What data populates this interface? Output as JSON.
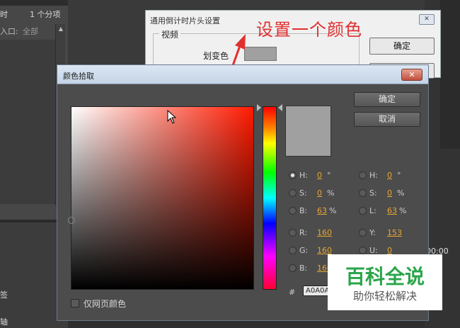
{
  "background_app": {
    "left_rows": [
      "时",
      "1 个分项",
      "入口:",
      "全部",
      "签",
      "轴"
    ]
  },
  "timecode": "00:00",
  "parent_dialog": {
    "title": "通用倒计时片头设置",
    "close_symbol": "✕",
    "group_label": "视频",
    "field_label": "划变色",
    "ok_label": "确定",
    "swatch_color": "#A0A0A0"
  },
  "annotation": {
    "text": "设置一个颜色",
    "color": "#E03030"
  },
  "picker": {
    "title": "颜色拾取",
    "close_symbol": "✕",
    "ok_label": "确定",
    "cancel_label": "取消",
    "preview_color": "#A0A0A0",
    "fields_left": [
      {
        "label": "H:",
        "value": "0",
        "unit": "°",
        "selected": true
      },
      {
        "label": "S:",
        "value": "0",
        "unit": "%",
        "selected": false
      },
      {
        "label": "B:",
        "value": "63",
        "unit": "%",
        "selected": false
      },
      {
        "label": "R:",
        "value": "160",
        "unit": "",
        "selected": false
      },
      {
        "label": "G:",
        "value": "160",
        "unit": "",
        "selected": false
      },
      {
        "label": "B:",
        "value": "160",
        "unit": "",
        "selected": false
      }
    ],
    "fields_right": [
      {
        "label": "H:",
        "value": "0",
        "unit": "°",
        "selected": false
      },
      {
        "label": "S:",
        "value": "0",
        "unit": "%",
        "selected": false
      },
      {
        "label": "L:",
        "value": "63",
        "unit": "%",
        "selected": false
      },
      {
        "label": "Y:",
        "value": "153",
        "unit": "",
        "selected": false
      },
      {
        "label": "U:",
        "value": "0",
        "unit": "",
        "selected": false
      }
    ],
    "hex_label": "#",
    "hex_value": "A0A0A0",
    "web_colors_label": "仅网页颜色",
    "web_colors_checked": false
  },
  "watermark": {
    "main": "百科全说",
    "sub": "助你轻松解决"
  }
}
